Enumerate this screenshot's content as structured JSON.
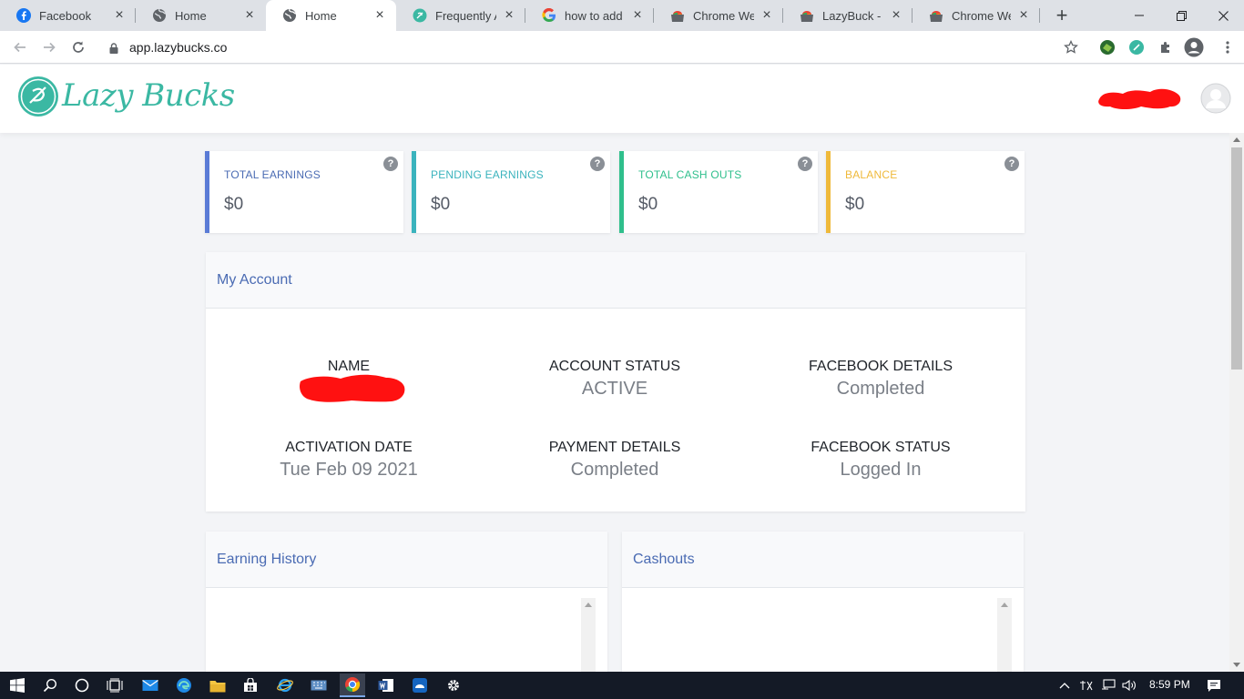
{
  "browser": {
    "tabs": [
      {
        "title": "Facebook",
        "icon": "facebook-icon"
      },
      {
        "title": "Home",
        "icon": "globe-icon"
      },
      {
        "title": "Home",
        "icon": "globe-icon"
      },
      {
        "title": "Frequently Ask",
        "icon": "lazybucks-icon"
      },
      {
        "title": "how to add ex",
        "icon": "google-icon"
      },
      {
        "title": "Chrome Web S",
        "icon": "chrome-webstore-icon"
      },
      {
        "title": "LazyBuck - Chr",
        "icon": "chrome-webstore-icon"
      },
      {
        "title": "Chrome Web S",
        "icon": "chrome-webstore-icon"
      }
    ],
    "active_tab_index": 2,
    "url": "app.lazybucks.co"
  },
  "app": {
    "logo_text": "Lazy Bucks",
    "brand_color": "#3bb8a3"
  },
  "stats": [
    {
      "label": "TOTAL EARNINGS",
      "value": "$0",
      "color": "#5a7bd6",
      "help": "?"
    },
    {
      "label": "PENDING EARNINGS",
      "value": "$0",
      "color": "#3ab3bd",
      "help": "?"
    },
    {
      "label": "TOTAL CASH OUTS",
      "value": "$0",
      "color": "#2fbf8c",
      "help": "?"
    },
    {
      "label": "BALANCE",
      "value": "$0",
      "color": "#efb93a",
      "help": "?"
    }
  ],
  "account": {
    "title": "My Account",
    "fields": [
      {
        "label": "NAME",
        "value": ""
      },
      {
        "label": "ACCOUNT STATUS",
        "value": "ACTIVE"
      },
      {
        "label": "FACEBOOK DETAILS",
        "value": "Completed"
      },
      {
        "label": "ACTIVATION DATE",
        "value": "Tue Feb 09 2021"
      },
      {
        "label": "PAYMENT DETAILS",
        "value": "Completed"
      },
      {
        "label": "FACEBOOK STATUS",
        "value": "Logged In"
      }
    ]
  },
  "earning_history": {
    "title": "Earning History"
  },
  "cashouts": {
    "title": "Cashouts"
  },
  "taskbar": {
    "time": "8:59 PM"
  }
}
